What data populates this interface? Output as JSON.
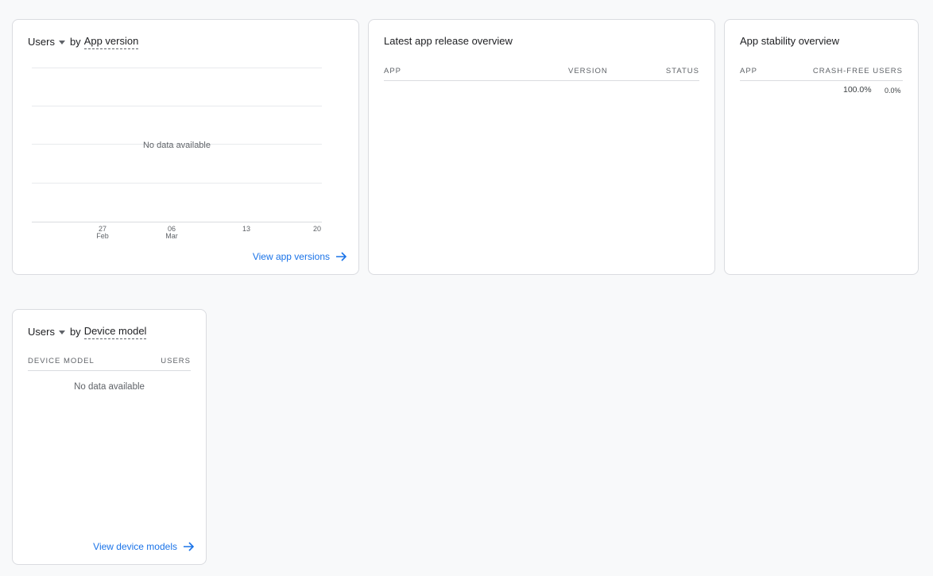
{
  "versions_card": {
    "metric": "Users",
    "by": "by",
    "dimension": "App version",
    "empty": "No data available",
    "x_ticks": [
      {
        "day": "27",
        "month": "Feb"
      },
      {
        "day": "06",
        "month": "Mar"
      },
      {
        "day": "13",
        "month": ""
      },
      {
        "day": "20",
        "month": ""
      }
    ],
    "link": "View app versions",
    "link_icon": "arrow-right-icon"
  },
  "release_card": {
    "title": "Latest app release overview",
    "columns": [
      "APP",
      "VERSION",
      "STATUS"
    ]
  },
  "stability_card": {
    "title": "App stability overview",
    "columns": [
      "APP",
      "CRASH-FREE USERS"
    ],
    "row": {
      "crash_free": "100.0%",
      "change": "0.0%"
    }
  },
  "devices_card": {
    "metric": "Users",
    "by": "by",
    "dimension": "Device model",
    "columns": [
      "DEVICE MODEL",
      "USERS"
    ],
    "empty": "No data available",
    "link": "View device models",
    "link_icon": "arrow-right-icon"
  },
  "colors": {
    "link": "#1a73e8",
    "border": "#dadce0",
    "background": "#f8f9fa"
  }
}
